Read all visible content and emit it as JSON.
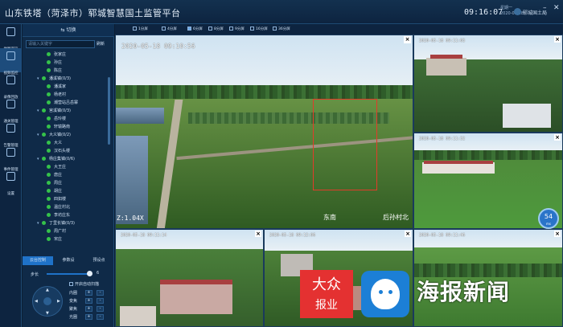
{
  "header": {
    "title": "山东铁塔（菏泽市）郓城智慧国土监管平台",
    "time": "09:16:07",
    "weekday": "星期一",
    "date": "2020-05-18",
    "user": "郓城国土局",
    "min_icon": "minimize-icon",
    "close_icon": "close-icon"
  },
  "nav": [
    {
      "label": "地图浏览",
      "icon": "map-icon"
    },
    {
      "label": "视频监控",
      "icon": "video-icon",
      "active": true
    },
    {
      "label": "录像回放",
      "icon": "playback-icon"
    },
    {
      "label": "通关管理",
      "icon": "shield-icon"
    },
    {
      "label": "告警管理",
      "icon": "bell-icon"
    },
    {
      "label": "事件管理",
      "icon": "event-icon"
    },
    {
      "label": "设置",
      "icon": "gear-icon"
    }
  ],
  "panel": {
    "switch_label": "切换",
    "search_placeholder": "请输入关键字",
    "refresh_label": "刷新",
    "tree": [
      {
        "label": "张家庄",
        "type": "cam",
        "indent": 2
      },
      {
        "label": "孙庄",
        "type": "cam",
        "indent": 2
      },
      {
        "label": "陈庄",
        "type": "cam",
        "indent": 2
      },
      {
        "label": "潘溪镇(0/3)",
        "type": "group",
        "indent": 1
      },
      {
        "label": "潘溪家",
        "type": "cam",
        "indent": 2
      },
      {
        "label": "杨老村",
        "type": "cam",
        "indent": 2
      },
      {
        "label": "潮营站吕岳寨",
        "type": "cam",
        "indent": 2
      },
      {
        "label": "宫溪镇(0/3)",
        "type": "group",
        "indent": 1
      },
      {
        "label": "岳玲楼",
        "type": "cam",
        "indent": 2
      },
      {
        "label": "轩辕路南",
        "type": "cam",
        "indent": 2
      },
      {
        "label": "大义镇(0/2)",
        "type": "group",
        "indent": 1
      },
      {
        "label": "大义",
        "type": "cam",
        "indent": 2
      },
      {
        "label": "汉石头楼",
        "type": "cam",
        "indent": 2
      },
      {
        "label": "杨庄集镇(0/6)",
        "type": "group",
        "indent": 1
      },
      {
        "label": "大王庄",
        "type": "cam",
        "indent": 2
      },
      {
        "label": "唐庄",
        "type": "cam",
        "indent": 2
      },
      {
        "label": "周庄",
        "type": "cam",
        "indent": 2
      },
      {
        "label": "胡庄",
        "type": "cam",
        "indent": 2
      },
      {
        "label": "四如楼",
        "type": "cam",
        "indent": 2
      },
      {
        "label": "温庄村北",
        "type": "cam",
        "indent": 2
      },
      {
        "label": "李坊庄东",
        "type": "cam",
        "indent": 2
      },
      {
        "label": "丁里长镇(0/3)",
        "type": "group",
        "indent": 1
      },
      {
        "label": "周广村",
        "type": "cam",
        "indent": 2
      },
      {
        "label": "宋庄",
        "type": "cam",
        "indent": 2
      }
    ],
    "tabs": [
      "云台控制",
      "参数设",
      "预设点"
    ],
    "step_label": "步长",
    "step_value": "6",
    "auto_scan_label": "开启自动扫描",
    "zoom_label": "变焦",
    "focus_label": "聚焦",
    "iris_label": "光圈",
    "dome_label": "内圈",
    "plus": "+",
    "minus": "-"
  },
  "toolbar": [
    {
      "label": "1分屏"
    },
    {
      "label": "4分屏"
    },
    {
      "label": "6分屏",
      "active": true
    },
    {
      "label": "8分屏"
    },
    {
      "label": "9分屏"
    },
    {
      "label": "16分屏"
    },
    {
      "label": "36分屏"
    }
  ],
  "cams": {
    "main_ts": "2020-05-18 09:10:56",
    "main_zoom": "Z:1.04X",
    "dir_left": "东南",
    "dir_right": "后孙村北",
    "small_ts": [
      "2020-05-18 09:11:03",
      "2020-05-18 09:11:32",
      "2020-05-18 09:11:14",
      "2020-05-18 09:12:06",
      "2020-05-18 09:11:46"
    ],
    "close_glyph": "×"
  },
  "gauge": {
    "value": "54",
    "unit": "ms"
  },
  "watermark": {
    "red_line1": "大众",
    "red_line2": "报业",
    "text": "海报新闻"
  }
}
